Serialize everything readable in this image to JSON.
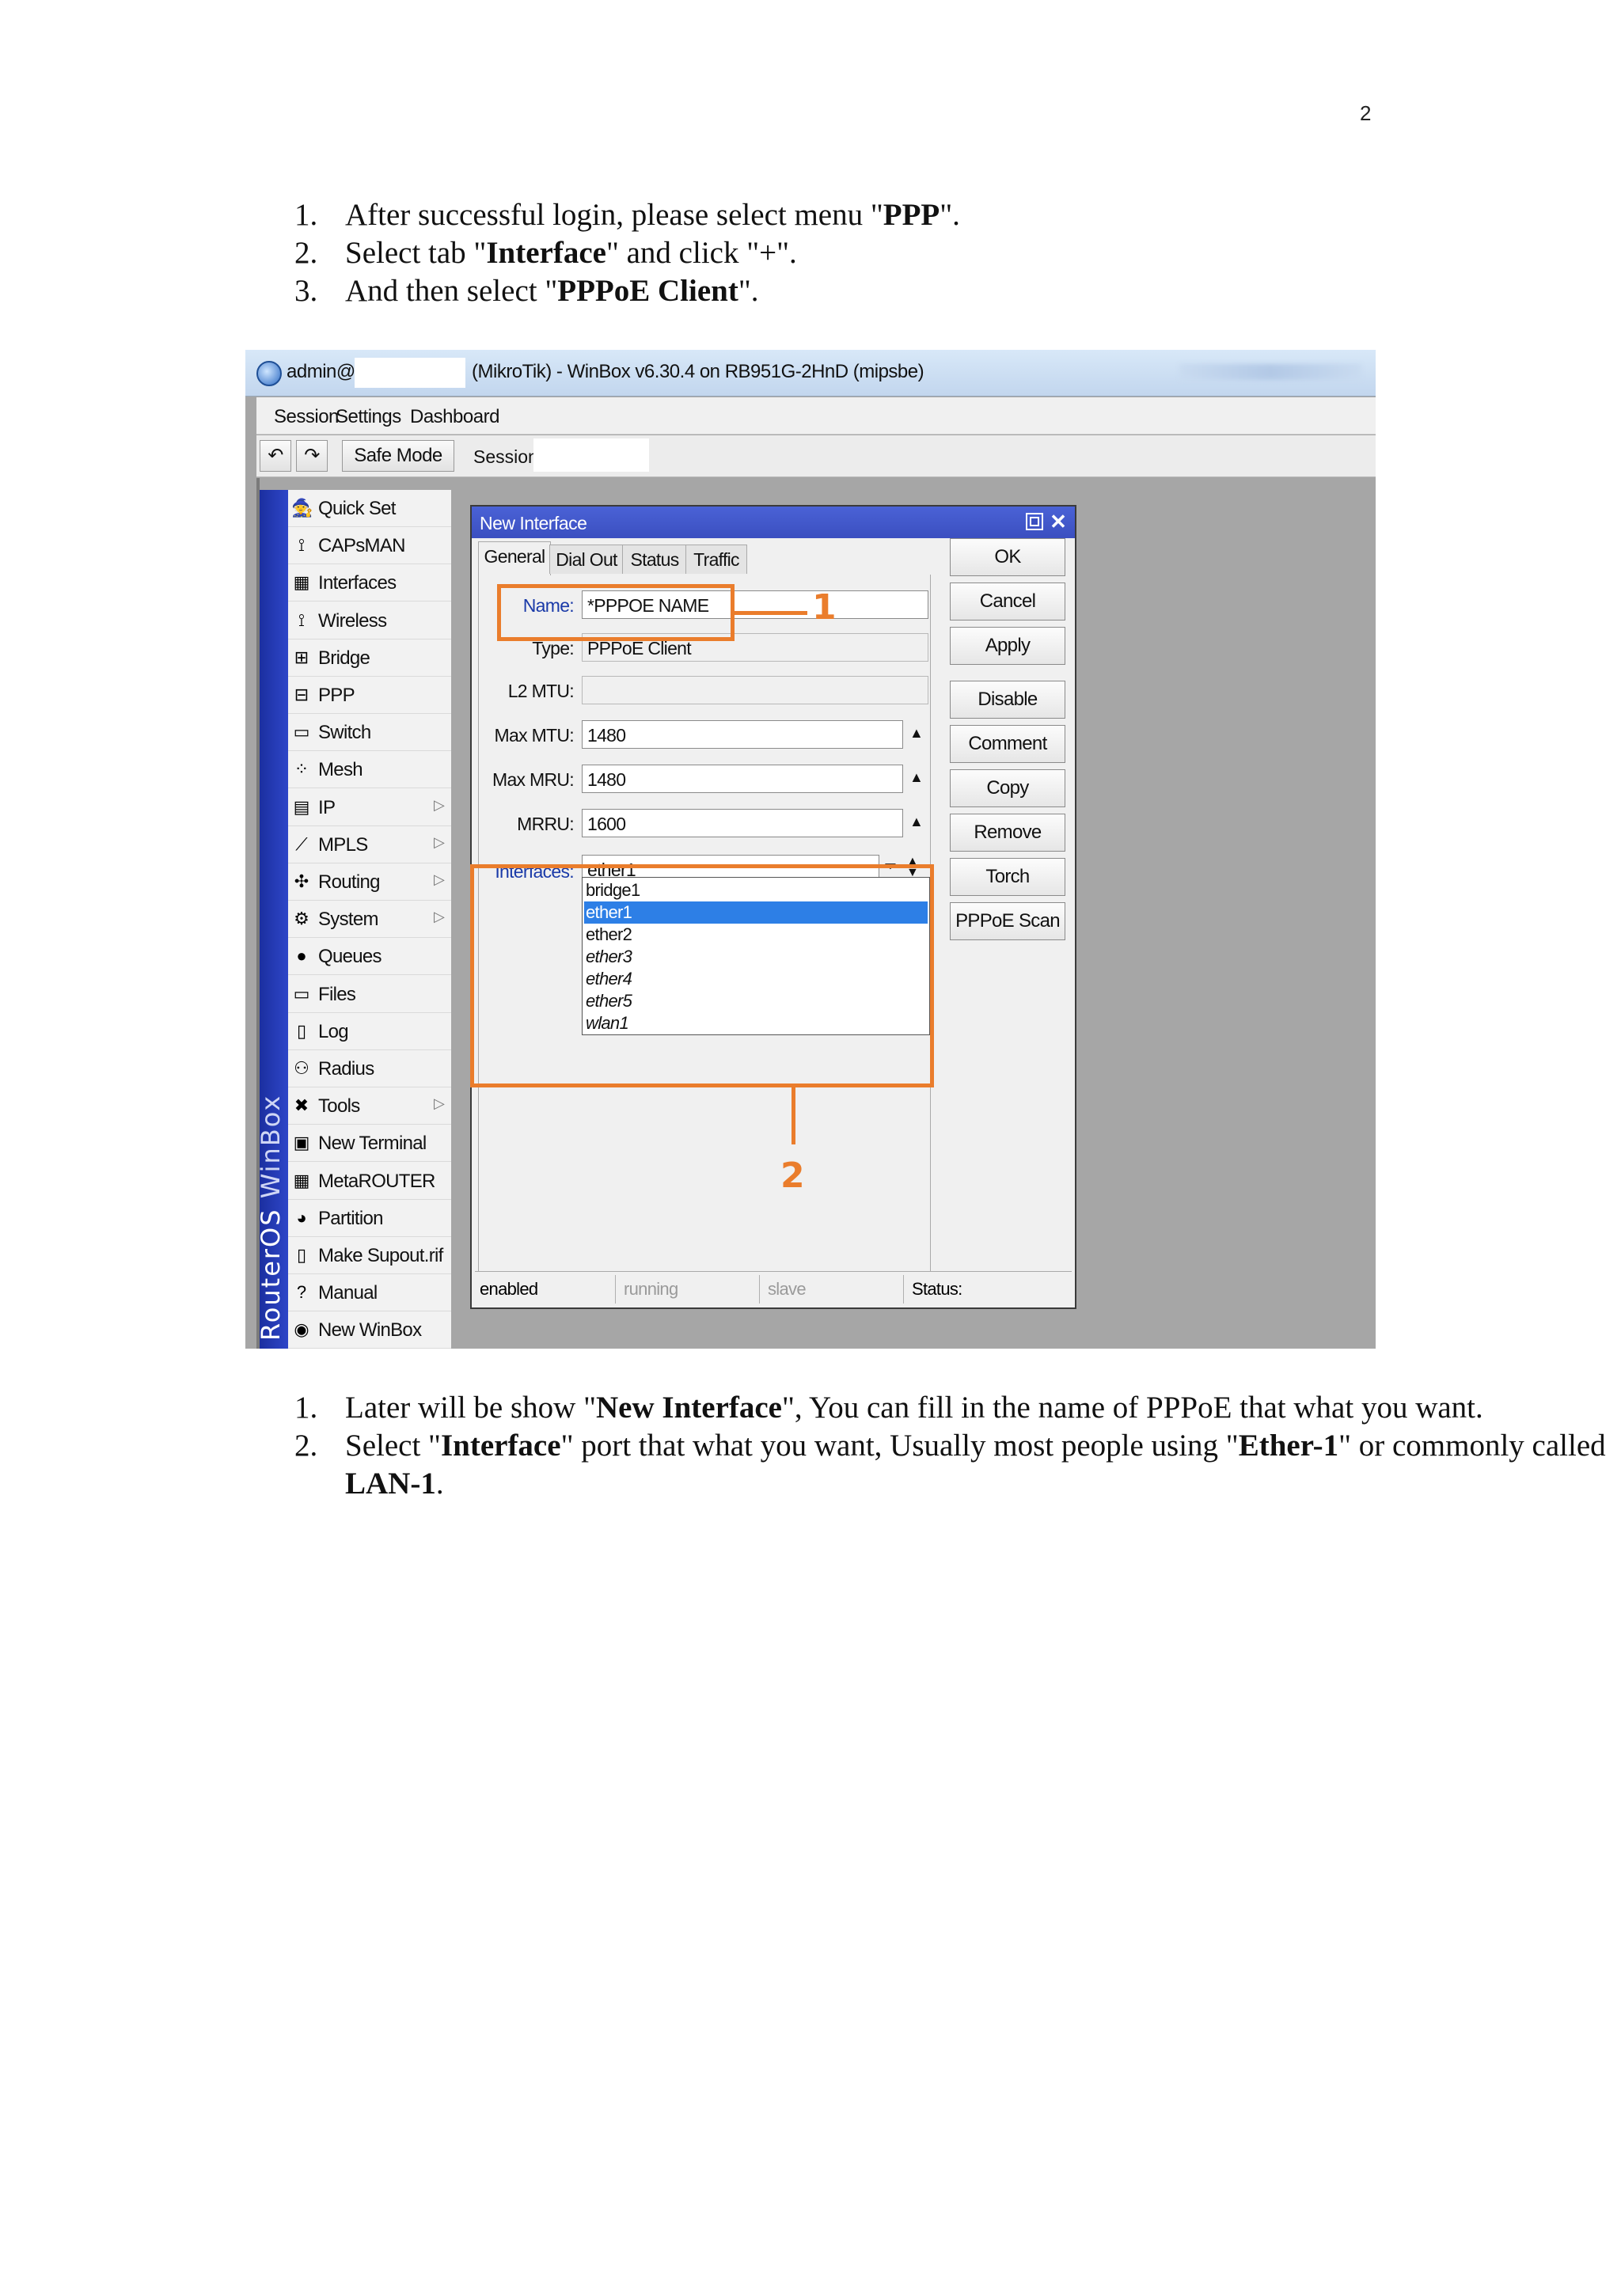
{
  "page": {
    "number": "2"
  },
  "instructions_top": [
    {
      "num": "1.",
      "before": "After successful login, please select menu \"",
      "bold": "PPP",
      "after": "\"."
    },
    {
      "num": "2.",
      "before": "Select tab \"",
      "bold": "Interface",
      "after": "\" and click \"+\"."
    },
    {
      "num": "3.",
      "before": "And then select \"",
      "bold": "PPPoE Client",
      "after": "\"."
    }
  ],
  "instructions_bottom": [
    {
      "num": "1.",
      "p1": "Later will be show \"",
      "b1": "New Interface",
      "p2": "\", You can fill in the name of PPPoE that what you want."
    },
    {
      "num": "2.",
      "p1": "Select \"",
      "b1": "Interface",
      "p2": "\" port that what you want, Usually most people using \"",
      "b2": "Ether-1",
      "p3": "\" or commonly called ",
      "b3": "LAN-1",
      "p4": "."
    }
  ],
  "window": {
    "title_left": "admin@",
    "title_right": "(MikroTik) - WinBox v6.30.4 on RB951G-2HnD (mipsbe)",
    "menu": [
      "Session",
      "Settings",
      "Dashboard"
    ],
    "toolbar": {
      "safe_mode": "Safe Mode",
      "session_label": "Session:",
      "undo_icon": "undo-icon",
      "redo_icon": "redo-icon"
    },
    "brand": {
      "part1": "RouterOS",
      "part2": "WinBox"
    }
  },
  "sidebar": {
    "items": [
      {
        "label": "Quick Set",
        "icon": "quick-set-icon",
        "glyph": "🧙",
        "submenu": false
      },
      {
        "label": "CAPsMAN",
        "icon": "antenna-icon",
        "glyph": "⟟",
        "submenu": false
      },
      {
        "label": "Interfaces",
        "icon": "interfaces-icon",
        "glyph": "▦",
        "submenu": false
      },
      {
        "label": "Wireless",
        "icon": "wireless-icon",
        "glyph": "⟟",
        "submenu": false
      },
      {
        "label": "Bridge",
        "icon": "bridge-icon",
        "glyph": "⊞",
        "submenu": false
      },
      {
        "label": "PPP",
        "icon": "ppp-icon",
        "glyph": "⊟",
        "submenu": false
      },
      {
        "label": "Switch",
        "icon": "switch-icon",
        "glyph": "▭",
        "submenu": false
      },
      {
        "label": "Mesh",
        "icon": "mesh-icon",
        "glyph": "⁘",
        "submenu": false
      },
      {
        "label": "IP",
        "icon": "ip-icon",
        "glyph": "▤",
        "submenu": true
      },
      {
        "label": "MPLS",
        "icon": "mpls-icon",
        "glyph": "⟋",
        "submenu": true
      },
      {
        "label": "Routing",
        "icon": "routing-icon",
        "glyph": "✣",
        "submenu": true
      },
      {
        "label": "System",
        "icon": "system-icon",
        "glyph": "⚙",
        "submenu": true
      },
      {
        "label": "Queues",
        "icon": "queues-icon",
        "glyph": "●",
        "submenu": false
      },
      {
        "label": "Files",
        "icon": "files-icon",
        "glyph": "▭",
        "submenu": false
      },
      {
        "label": "Log",
        "icon": "log-icon",
        "glyph": "▯",
        "submenu": false
      },
      {
        "label": "Radius",
        "icon": "radius-icon",
        "glyph": "⚇",
        "submenu": false
      },
      {
        "label": "Tools",
        "icon": "tools-icon",
        "glyph": "✖",
        "submenu": true
      },
      {
        "label": "New Terminal",
        "icon": "terminal-icon",
        "glyph": "▣",
        "submenu": false
      },
      {
        "label": "MetaROUTER",
        "icon": "metarouter-icon",
        "glyph": "▦",
        "submenu": false
      },
      {
        "label": "Partition",
        "icon": "partition-icon",
        "glyph": "◕",
        "submenu": false
      },
      {
        "label": "Make Supout.rif",
        "icon": "supout-icon",
        "glyph": "▯",
        "submenu": false
      },
      {
        "label": "Manual",
        "icon": "manual-icon",
        "glyph": "?",
        "submenu": false
      },
      {
        "label": "New WinBox",
        "icon": "winbox-icon",
        "glyph": "◉",
        "submenu": false
      }
    ],
    "submenu_arrow": "▷"
  },
  "dialog": {
    "title": "New Interface",
    "tabs": [
      "General",
      "Dial Out",
      "Status",
      "Traffic"
    ],
    "fields": {
      "name": {
        "label": "Name:",
        "value": "*PPPOE NAME"
      },
      "type": {
        "label": "Type:",
        "value": "PPPoE Client"
      },
      "l2mtu": {
        "label": "L2 MTU:",
        "value": ""
      },
      "max_mtu": {
        "label": "Max MTU:",
        "value": "1480"
      },
      "max_mru": {
        "label": "Max MRU:",
        "value": "1480"
      },
      "mrru": {
        "label": "MRRU:",
        "value": "1600"
      },
      "interfaces": {
        "label": "Interfaces:",
        "value": "ether1"
      }
    },
    "interface_options": [
      "bridge1",
      "ether1",
      "ether2",
      "ether3",
      "ether4",
      "ether5",
      "wlan1"
    ],
    "selected_option": "ether1",
    "buttons": [
      "OK",
      "Cancel",
      "Apply",
      "Disable",
      "Comment",
      "Copy",
      "Remove",
      "Torch",
      "PPPoE Scan"
    ],
    "status_bar": [
      "enabled",
      "running",
      "slave",
      "Status:"
    ]
  },
  "annotations": {
    "callout_1": "1",
    "callout_2": "2",
    "color": "#ea7d2c"
  }
}
